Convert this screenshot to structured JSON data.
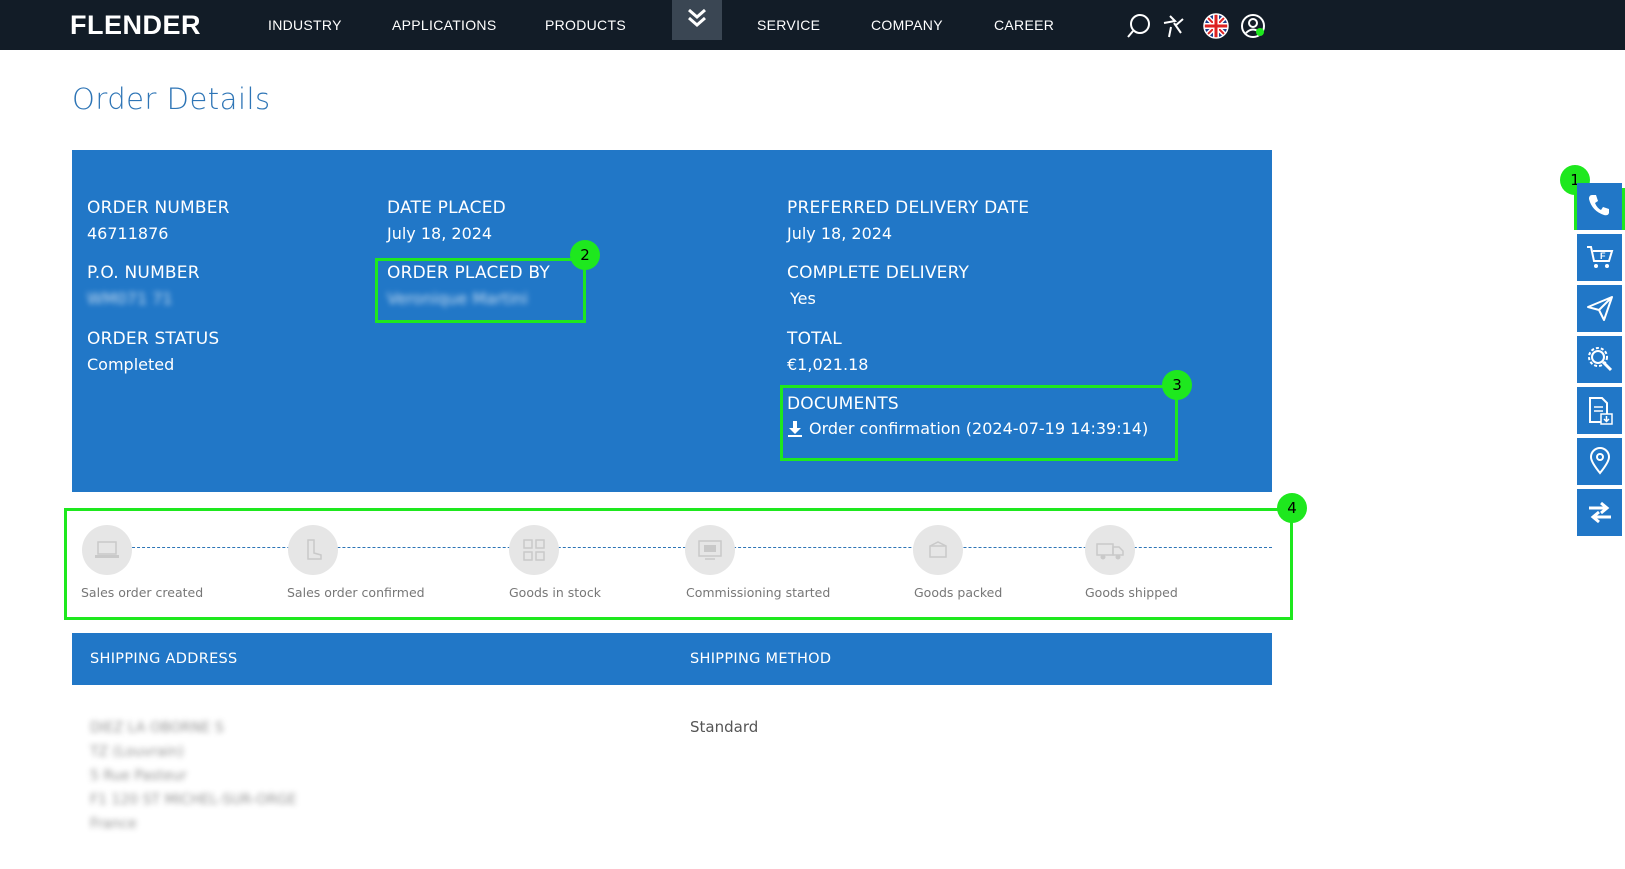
{
  "header": {
    "logo": "FLENDER",
    "nav": [
      "INDUSTRY",
      "APPLICATIONS",
      "PRODUCTS",
      "SERVICE",
      "COMPANY",
      "CAREER"
    ],
    "icons": [
      "chevron-down-icon",
      "search-icon",
      "flender-service-icon",
      "uk-flag-icon",
      "user-account-icon"
    ]
  },
  "page_title": "Order Details",
  "order": {
    "order_number_label": "ORDER NUMBER",
    "order_number": "46711876",
    "po_number_label": "P.O. NUMBER",
    "po_number": "WM071 71",
    "order_status_label": "ORDER STATUS",
    "order_status": "Completed",
    "date_placed_label": "DATE PLACED",
    "date_placed": "July 18, 2024",
    "placed_by_label": "ORDER PLACED BY",
    "placed_by": "Veronique Martini",
    "preferred_delivery_label": "PREFERRED DELIVERY DATE",
    "preferred_delivery": "July 18, 2024",
    "complete_delivery_label": "COMPLETE DELIVERY",
    "complete_delivery": "Yes",
    "total_label": "TOTAL",
    "total": "€1,021.18",
    "documents_label": "DOCUMENTS",
    "document_link": "Order confirmation (2024-07-19 14:39:14)"
  },
  "progress_steps": [
    {
      "label": "Sales order created",
      "icon": "laptop-icon"
    },
    {
      "label": "Sales order confirmed",
      "icon": "boot-icon"
    },
    {
      "label": "Goods in stock",
      "icon": "shelves-icon"
    },
    {
      "label": "Commissioning started",
      "icon": "monitor-icon"
    },
    {
      "label": "Goods packed",
      "icon": "package-icon"
    },
    {
      "label": "Goods shipped",
      "icon": "truck-icon"
    }
  ],
  "shipping": {
    "address_label": "SHIPPING ADDRESS",
    "method_label": "SHIPPING METHOD",
    "address_lines": [
      "DIEZ LA OBORNE S",
      "TZ (Louvrain)",
      "5 Rue Pasteur",
      "F1 120 ST MICHEL-SUR-ORGE",
      "France"
    ],
    "method": "Standard"
  },
  "annotations": [
    "1",
    "2",
    "3",
    "4"
  ],
  "sidebar_icons": [
    "phone-icon",
    "cart-icon",
    "send-icon",
    "wrench-gear-icon",
    "document-download-icon",
    "location-pin-icon",
    "exchange-arrows-icon"
  ],
  "colors": {
    "primary": "#2177c7",
    "header_bg": "#121c27",
    "highlight": "#1ee81e",
    "title": "#2e75b6"
  }
}
